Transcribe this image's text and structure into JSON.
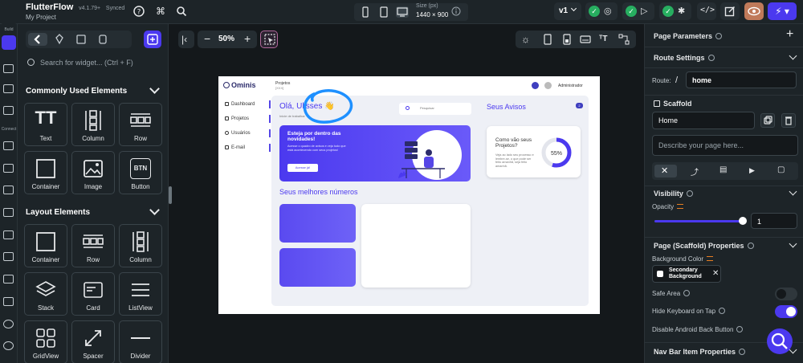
{
  "topbar": {
    "app_name": "FlutterFlow",
    "version": "v4.1.79+",
    "sync_status": "Synced",
    "project": "My Project",
    "size_label": "Size (px)",
    "size_value": "1440 × 900",
    "branch": "v1"
  },
  "rail": {
    "build_label": "Build",
    "connect_label": "Connect"
  },
  "widget_panel": {
    "search_placeholder": "Search for widget... (Ctrl + F)",
    "common_title": "Commonly Used Elements",
    "common": [
      {
        "label": "Text",
        "icon": "text-icon"
      },
      {
        "label": "Column",
        "icon": "column-icon"
      },
      {
        "label": "Row",
        "icon": "row-icon"
      },
      {
        "label": "Container",
        "icon": "container-icon"
      },
      {
        "label": "Image",
        "icon": "image-icon"
      },
      {
        "label": "Button",
        "icon": "button-icon"
      }
    ],
    "layout_title": "Layout Elements",
    "layout": [
      {
        "label": "Container",
        "icon": "container-icon"
      },
      {
        "label": "Row",
        "icon": "row-icon"
      },
      {
        "label": "Column",
        "icon": "column-icon"
      },
      {
        "label": "Stack",
        "icon": "stack-icon"
      },
      {
        "label": "Card",
        "icon": "card-icon"
      },
      {
        "label": "ListView",
        "icon": "listview-icon"
      },
      {
        "label": "GridView",
        "icon": "gridview-icon"
      },
      {
        "label": "Spacer",
        "icon": "spacer-icon"
      },
      {
        "label": "Divider",
        "icon": "divider-icon"
      }
    ],
    "btn_glyph": "BTN",
    "text_glyph": "TT"
  },
  "canvas": {
    "zoom": "50%",
    "minus": "−",
    "plus": "+"
  },
  "frame": {
    "logo": "Ominis",
    "nav": [
      "Dashboard",
      "Projetos",
      "Usuários",
      "E-mail"
    ],
    "crumb": "Projetos",
    "crumb_sub": "[XXX]",
    "admin": "Administrador",
    "hello": "Olá, Ulisses 👋",
    "hello_sub": "Inicie de trabalhar",
    "search": "Pesquisar",
    "avisos": "Seus Avisos",
    "badge": "2",
    "banner_title": "Esteja por dentro das novidades!",
    "banner_text": "Acesse o quadro de avisos e veja tudo que está acontecendo com seus projetos!",
    "banner_btn": "Acesse já!",
    "card_title": "Como vão seus Projetos?",
    "card_text": "Veja ao lado seu processo e lembre-se, o que pode ser feito amanhã, seja feito amanhã.",
    "card_percent": 55,
    "card_percent_label": "55%",
    "best": "Seus melhores números"
  },
  "right_panel": {
    "page_params": "Page Parameters",
    "route_settings": "Route Settings",
    "route_label": "Route:",
    "route_slash": "/",
    "route_value": "home",
    "scaffold": "Scaffold",
    "page_name": "Home",
    "desc_placeholder": "Describe your page here...",
    "visibility": "Visibility",
    "opacity": "Opacity",
    "opacity_value": "1",
    "opacity_level": 1,
    "props_title": "Page (Scaffold) Properties",
    "bg_color_label": "Background Color",
    "bg_color_value": "Secondary Background",
    "safe_area": "Safe Area",
    "safe_area_on": false,
    "hide_kb": "Hide Keyboard on Tap",
    "hide_kb_on": true,
    "disable_back": "Disable Android Back Button",
    "nav_bar": "Nav Bar Item Properties"
  },
  "colors": {
    "accent": "#4b39ef",
    "panel": "#1d2428",
    "background": "#14181b",
    "success": "#27ae60",
    "eye": "#c07a5a"
  }
}
